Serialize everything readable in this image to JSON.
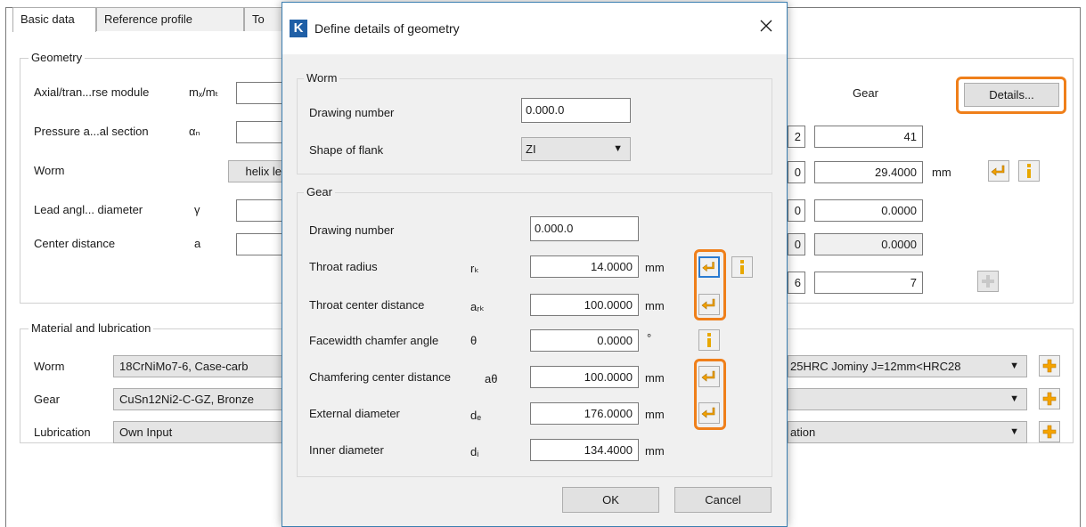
{
  "tabs": [
    {
      "label": "Basic data"
    },
    {
      "label": "Reference profile"
    },
    {
      "label": "To"
    }
  ],
  "geometry": {
    "legend": "Geometry",
    "rows": [
      {
        "label": "Axial/tran...rse module",
        "symbol": "mₓ/mₜ"
      },
      {
        "label": "Pressure a...al section",
        "symbol": "αₙ"
      },
      {
        "label": "Worm",
        "symbol": ""
      },
      {
        "label": "Lead angl... diameter",
        "symbol": "γ"
      },
      {
        "label": "Center distance",
        "symbol": "a"
      }
    ],
    "worm_field_text": "helix le",
    "gear_header": "Gear",
    "details_button": "Details...",
    "left_column_fragments": [
      "2",
      "0",
      "0",
      "0",
      "6"
    ],
    "gear_values": [
      "41",
      "29.4000",
      "0.0000",
      "0.0000",
      "7"
    ],
    "gear_unit": "mm"
  },
  "material": {
    "legend": "Material and lubrication",
    "rows": [
      {
        "label": "Worm",
        "left_value": "18CrNiMo7-6, Case-carb",
        "right_value": "25HRC Jominy J=12mm<HRC28"
      },
      {
        "label": "Gear",
        "left_value": "CuSn12Ni2-C-GZ, Bronze",
        "right_value": ""
      },
      {
        "label": "Lubrication",
        "left_value": "Own Input",
        "right_value": "ation"
      }
    ]
  },
  "dialog": {
    "title": "Define details of geometry",
    "app_icon_letter": "K",
    "worm_group": {
      "legend": "Worm",
      "drawing_number_label": "Drawing number",
      "drawing_number_value": "0.000.0",
      "shape_of_flank_label": "Shape of flank",
      "shape_of_flank_value": "ZI"
    },
    "gear_group": {
      "legend": "Gear",
      "drawing_number_label": "Drawing number",
      "drawing_number_value": "0.000.0",
      "rows": [
        {
          "label": "Throat radius",
          "symbol": "rₖ",
          "value": "14.0000",
          "unit": "mm"
        },
        {
          "label": "Throat center distance",
          "symbol": "aᵣₖ",
          "value": "100.0000",
          "unit": "mm"
        },
        {
          "label": "Facewidth chamfer angle",
          "symbol": "θ",
          "value": "0.0000",
          "unit": "°"
        },
        {
          "label": "Chamfering center distance",
          "symbol": "aθ",
          "value": "100.0000",
          "unit": "mm"
        },
        {
          "label": "External diameter",
          "symbol": "dₑ",
          "value": "176.0000",
          "unit": "mm"
        },
        {
          "label": "Inner diameter",
          "symbol": "dᵢ",
          "value": "134.4000",
          "unit": "mm"
        }
      ]
    },
    "ok_button": "OK",
    "cancel_button": "Cancel"
  },
  "colors": {
    "highlight": "#ef7f1a",
    "arrow_icon": "#f2a100",
    "info_icon": "#e8a800",
    "plus_icon": "#f5a300",
    "dialog_border": "#3c7fb1",
    "kisssoft_logo": "#1f5fa6"
  },
  "icons": [
    "arrow-left-icon",
    "info-icon",
    "plus-icon",
    "close-icon",
    "dropdown-arrow-icon",
    "app-logo-icon"
  ]
}
